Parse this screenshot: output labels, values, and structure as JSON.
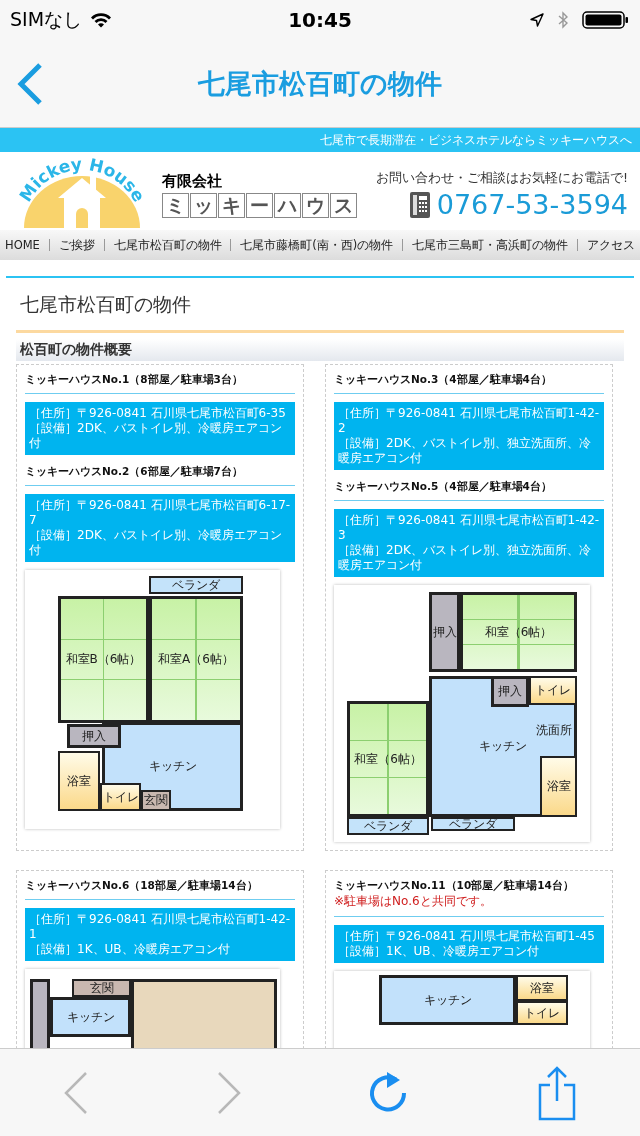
{
  "status_bar": {
    "carrier": "SIMなし",
    "time": "10:45"
  },
  "nav": {
    "title": "七尾市松百町の物件"
  },
  "site": {
    "tagline": "七尾市で長期滞在・ビジネスホテルならミッキーハウスへ",
    "logo_text": "Mickey House",
    "company_type": "有限会社",
    "company_name_chars": [
      "ミ",
      "ッ",
      "キ",
      "ー",
      "ハ",
      "ウ",
      "ス"
    ],
    "contact_note": "お問い合わせ・ご相談はお気軽にお電話で!",
    "phone": "0767-53-3594"
  },
  "menu": [
    "HOME",
    "ご挨拶",
    "七尾市松百町の物件",
    "七尾市藤橋町(南・西)の物件",
    "七尾市三島町・高浜町の物件",
    "アクセス"
  ],
  "page_title": "七尾市松百町の物件",
  "section_title": "松百町の物件概要",
  "properties": [
    {
      "houses": [
        {
          "name": "ミッキーハウスNo.1（8部屋／駐車場3台）",
          "address": "［住所］〒926-0841 石川県七尾市松百町6-35",
          "facilities": "［設備］2DK、バストイレ別、冷暖房エアコン付"
        },
        {
          "name": "ミッキーハウスNo.2（6部屋／駐車場7台）",
          "address": "［住所］〒926-0841 石川県七尾市松百町6-17-7",
          "facilities": "［設備］2DK、バストイレ別、冷暖房エアコン付"
        }
      ],
      "plan": {
        "rooms": [
          {
            "label": "ベランダ",
            "kind": "balcony"
          },
          {
            "label": "和室B（6帖）",
            "kind": "tatami"
          },
          {
            "label": "和室A（6帖）",
            "kind": "tatami"
          },
          {
            "label": "キッチン",
            "kind": "floor"
          },
          {
            "label": "押入",
            "kind": "closet"
          },
          {
            "label": "浴室",
            "kind": "bath"
          },
          {
            "label": "トイレ",
            "kind": "toilet"
          },
          {
            "label": "玄関",
            "kind": "entry"
          }
        ]
      }
    },
    {
      "houses": [
        {
          "name": "ミッキーハウスNo.3（4部屋／駐車場4台）",
          "address": "［住所］〒926-0841 石川県七尾市松百町1-42-2",
          "facilities": "［設備］2DK、バストイレ別、独立洗面所、冷暖房エアコン付"
        },
        {
          "name": "ミッキーハウスNo.5（4部屋／駐車場4台）",
          "address": "［住所］〒926-0841 石川県七尾市松百町1-42-3",
          "facilities": "［設備］2DK、バストイレ別、独立洗面所、冷暖房エアコン付"
        }
      ],
      "plan": {
        "rooms": [
          {
            "label": "キッチン",
            "kind": "floor"
          },
          {
            "label": "押入",
            "kind": "closet"
          },
          {
            "label": "和室（6帖）",
            "kind": "tatami"
          },
          {
            "label": "押入",
            "kind": "closet"
          },
          {
            "label": "トイレ",
            "kind": "toilet"
          },
          {
            "label": "和室（6帖）",
            "kind": "tatami"
          },
          {
            "label": "洗面所",
            "kind": "washroom"
          },
          {
            "label": "浴室",
            "kind": "bath"
          },
          {
            "label": "ベランダ",
            "kind": "balcony"
          },
          {
            "label": "ベランダ",
            "kind": "balcony"
          }
        ]
      }
    },
    {
      "houses": [
        {
          "name": "ミッキーハウスNo.6（18部屋／駐車場14台）",
          "address": "［住所］〒926-0841 石川県七尾市松百町1-42-1",
          "facilities": "［設備］1K、UB、冷暖房エアコン付"
        }
      ],
      "plan": {
        "rooms": [
          {
            "label": "玄関",
            "kind": "entry"
          },
          {
            "label": "キッチン",
            "kind": "floor"
          }
        ]
      }
    },
    {
      "houses": [
        {
          "name": "ミッキーハウスNo.11（10部屋／駐車場14台）",
          "note": "※駐車場はNo.6と共同です。",
          "address": "［住所］〒926-0841 石川県七尾市松百町1-45",
          "facilities": "［設備］1K、UB、冷暖房エアコン付"
        }
      ],
      "plan": {
        "rooms": [
          {
            "label": "キッチン",
            "kind": "floor"
          },
          {
            "label": "浴室",
            "kind": "bath"
          },
          {
            "label": "トイレ",
            "kind": "toilet"
          }
        ]
      }
    }
  ]
}
